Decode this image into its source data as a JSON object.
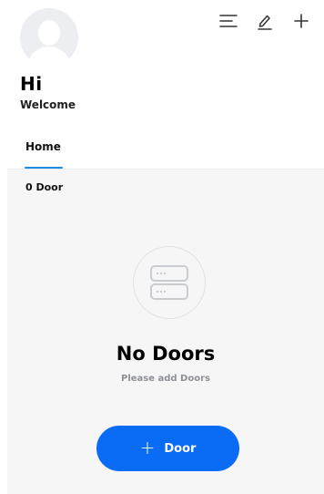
{
  "header": {
    "greeting": "Hi",
    "subtitle": "Welcome",
    "icons": [
      "menu-icon",
      "edit-icon",
      "add-icon"
    ]
  },
  "tabs": [
    {
      "label": "Home",
      "active": true
    }
  ],
  "content": {
    "door_count": "0 Door",
    "empty_title": "No Doors",
    "empty_subtitle": "Please add Doors",
    "add_button_label": "Door"
  },
  "colors": {
    "accent": "#0a6cf5",
    "tab_underline": "#1b8fe6",
    "content_bg": "#f6f6f7",
    "muted_text": "#8c8f93"
  }
}
